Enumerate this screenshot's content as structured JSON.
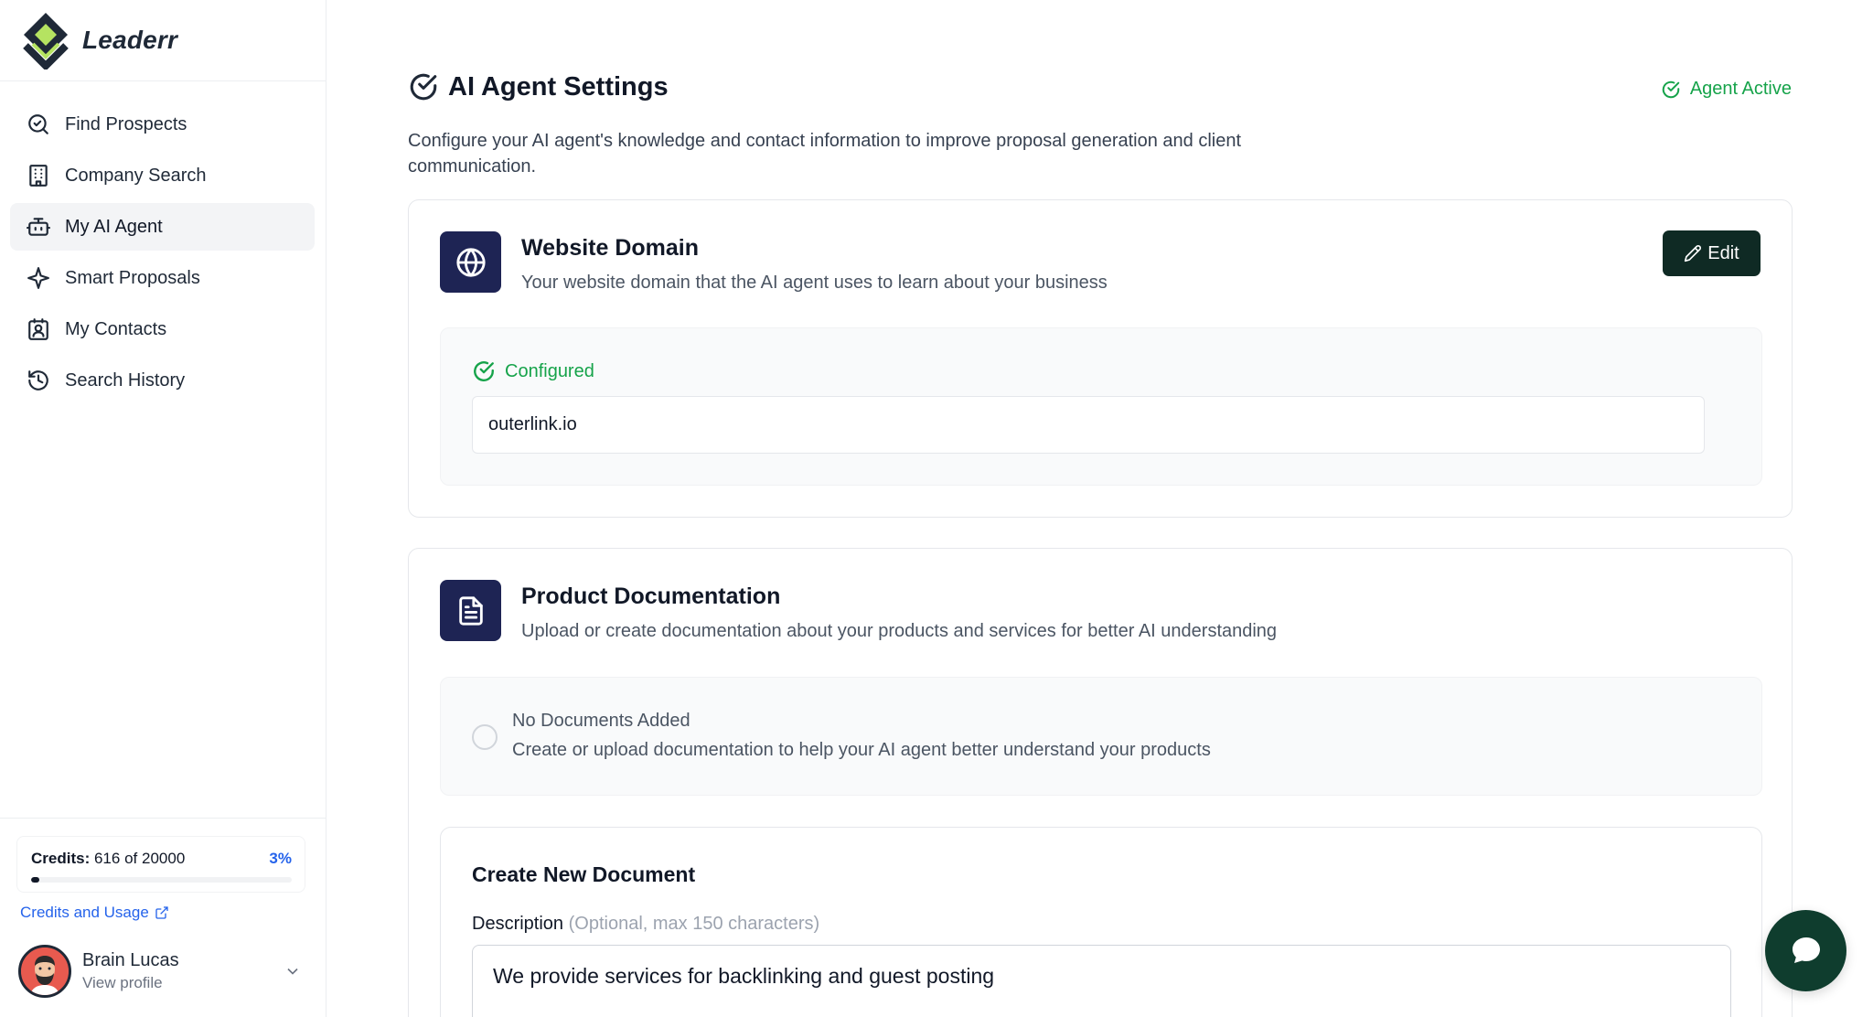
{
  "brand": {
    "name": "Leaderr"
  },
  "nav": {
    "items": [
      {
        "label": "Find Prospects",
        "icon": "search-icon",
        "active": false
      },
      {
        "label": "Company Search",
        "icon": "building-icon",
        "active": false
      },
      {
        "label": "My AI Agent",
        "icon": "bot-icon",
        "active": true
      },
      {
        "label": "Smart Proposals",
        "icon": "sparkle-icon",
        "active": false
      },
      {
        "label": "My Contacts",
        "icon": "contact-icon",
        "active": false
      },
      {
        "label": "Search History",
        "icon": "history-icon",
        "active": false
      }
    ]
  },
  "credits": {
    "label": "Credits:",
    "used": "616",
    "of_text": "of",
    "total": "20000",
    "percent_text": "3%",
    "fraction": 0.03,
    "link_label": "Credits and Usage"
  },
  "profile": {
    "name": "Brain Lucas",
    "sub": "View profile"
  },
  "page": {
    "title": "AI Agent Settings",
    "status": "Agent Active",
    "description": "Configure your AI agent's knowledge and contact information to improve proposal generation and client communication."
  },
  "website_card": {
    "title": "Website Domain",
    "subtitle": "Your website domain that the AI agent uses to learn about your business",
    "edit_label": "Edit",
    "status": "Configured",
    "domain": "outerlink.io"
  },
  "docs_card": {
    "title": "Product Documentation",
    "subtitle": "Upload or create documentation about your products and services for better AI understanding",
    "empty_title": "No Documents Added",
    "empty_sub": "Create or upload documentation to help your AI agent better understand your products",
    "create_title": "Create New Document",
    "desc_label": "Description",
    "desc_hint": "(Optional, max 150 characters)",
    "desc_value": "We provide services for backlinking and guest posting"
  },
  "colors": {
    "accent_green": "#16a34a",
    "icon_tile": "#1e2454",
    "edit_button": "#0f2a24",
    "link_blue": "#2563eb",
    "chat_fab": "#0f3d2e"
  }
}
